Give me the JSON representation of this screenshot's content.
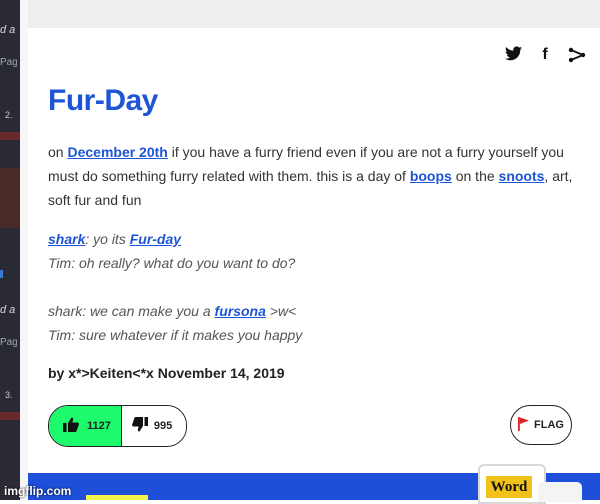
{
  "left_panel": {
    "tab_a": "d a",
    "tab_pag": "Pag",
    "num1": "2.",
    "tab_a2": "d a",
    "tab_pag2": "Pag",
    "num2": "3."
  },
  "share": {
    "twitter_icon": "twitter-icon",
    "facebook_icon": "facebook-icon",
    "share_icon": "share-icon",
    "facebook_glyph": "f"
  },
  "entry": {
    "title": "Fur-Day",
    "meaning": {
      "p1": "on ",
      "link_date": "December 20th",
      "p2": " if you have a furry friend even if you are not a furry yourself you must do something furry related with them. this is a day of ",
      "link_boops": "boops",
      "p3": " on the ",
      "link_snoots": "snoots",
      "p4": ", art, soft fur and fun"
    },
    "example": {
      "line1_link": "shark",
      "line1_text": ": yo its ",
      "line1_link2": "Fur-day",
      "line2": "Tim: oh really? what do you want to do?",
      "line3_text": "shark: we can make you a ",
      "line3_link": "fursona",
      "line3_end": " >w<",
      "line4": "Tim: sure whatever if it makes you happy"
    },
    "author": "by x*>Keiten<*x November 14, 2019"
  },
  "votes": {
    "up_count": "1127",
    "down_count": "995",
    "flag_label": "FLAG"
  },
  "banner": {
    "mug_label": "Word"
  },
  "watermark": "imgflip.com",
  "colors": {
    "link_blue": "#1d55d6",
    "upvote_green": "#1dfa6b",
    "banner_blue": "#1d4fd8",
    "flag_red": "#e02020"
  }
}
